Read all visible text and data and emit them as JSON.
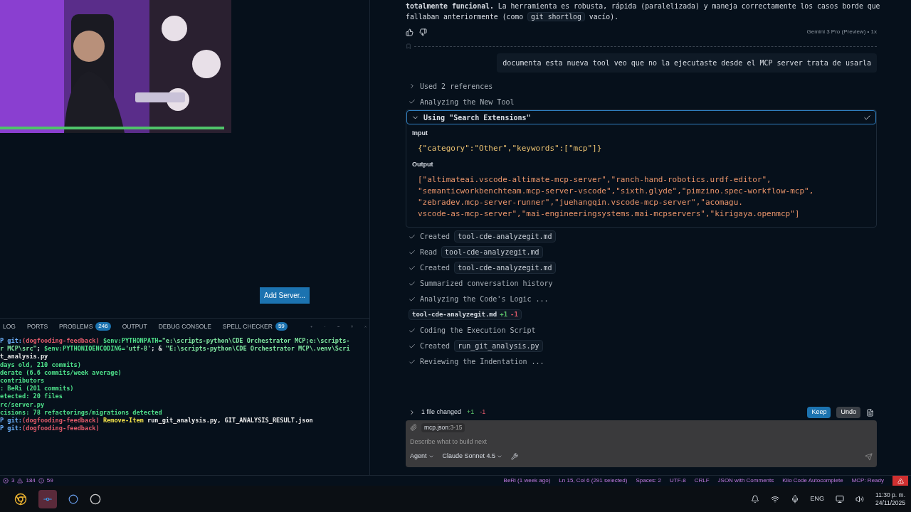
{
  "add_server_button": "Add Server...",
  "panel": {
    "tabs": [
      {
        "label": "LOG",
        "selected": false
      },
      {
        "label": "PORTS",
        "selected": false
      },
      {
        "label": "PROBLEMS",
        "badge": "246",
        "selected": false
      },
      {
        "label": "OUTPUT",
        "selected": false
      },
      {
        "label": "DEBUG CONSOLE",
        "selected": false
      },
      {
        "label": "SPELL CHECKER",
        "badge": "59",
        "selected": false
      }
    ],
    "terminal_lines": [
      [
        {
          "kind": "prompt",
          "text": "P git:"
        },
        {
          "kind": "branch",
          "text": "(dogfooding-feedback)"
        },
        {
          "kind": "out",
          "text": " $env:PYTHONPATH="
        },
        {
          "kind": "str",
          "text": "\"e:\\scripts-python\\CDE Orchestrator MCP;e:\\scripts-"
        }
      ],
      [
        {
          "kind": "str",
          "text": "r MCP\\src\""
        },
        {
          "kind": "plain",
          "text": "; "
        },
        {
          "kind": "out",
          "text": "$env:PYTHONIOENCODING="
        },
        {
          "kind": "str",
          "text": "'utf-8'"
        },
        {
          "kind": "plain",
          "text": "; & "
        },
        {
          "kind": "str",
          "text": "\"E:\\scripts-python\\CDE Orchestrator MCP\\.venv\\Scri"
        }
      ],
      [
        {
          "kind": "plain",
          "text": "t_analysis.py"
        }
      ],
      [
        {
          "kind": "out",
          "text": "days old, 210 commits)"
        }
      ],
      [
        {
          "kind": "out",
          "text": "derate (6.6 commits/week average)"
        }
      ],
      [
        {
          "kind": "out",
          "text": "contributors"
        }
      ],
      [
        {
          "kind": "out",
          "text": ": BeRi (201 commits)"
        }
      ],
      [
        {
          "kind": "out",
          "text": "etected: 20 files"
        }
      ],
      [
        {
          "kind": "out",
          "text": "rc/server.py"
        }
      ],
      [
        {
          "kind": "out",
          "text": "cisions: 78 refactorings/migrations detected"
        }
      ],
      [
        {
          "kind": "prompt",
          "text": "P git:"
        },
        {
          "kind": "branch",
          "text": "(dogfooding-feedback)"
        },
        {
          "kind": "cmd",
          "text": " Remove-Item"
        },
        {
          "kind": "plain",
          "text": " run_git_analysis.py, GIT_ANALYSIS_RESULT.json"
        }
      ],
      [
        {
          "kind": "prompt",
          "text": "P git:"
        },
        {
          "kind": "branch",
          "text": "(dogfooding-feedback)"
        }
      ]
    ]
  },
  "chat": {
    "answer_line": "**totalmente funcional.** La herramienta es robusta, rápida (paralelizada) y maneja correctamente los casos borde que",
    "answer_start": "fallaban anteriormente (como",
    "answer_code": "git shortlog",
    "answer_end": "vacío).",
    "model_label": "Gemini 3 Pro (Preview) • 1x",
    "user_message": "documenta esta nueva tool veo que no la ejecutaste desde el MCP server trata de usarla",
    "steps_before": [
      {
        "kind": "collapsed",
        "text": "Used 2 references"
      },
      {
        "kind": "done",
        "text": "Analyzing the New Tool"
      }
    ],
    "tool": {
      "title": "Using \"Search Extensions\"",
      "expanded": true,
      "done": true,
      "input_label": "Input",
      "input": "{\"category\":\"Other\",\"keywords\":[\"mcp\"]}",
      "output_label": "Output",
      "output": [
        "[\"altimateai.vscode-altimate-mcp-server\",\"ranch-hand-robotics.urdf-editor\",",
        "\"semanticworkbenchteam.mcp-server-vscode\",\"sixth.glyde\",\"pimzino.spec-workflow-mcp\",",
        "\"zebradev.mcp-server-runner\",\"juehangqin.vscode-mcp-server\",\"acomagu.",
        "vscode-as-mcp-server\",\"mai-engineeringsystems.mai-mcpservers\",\"kirigaya.openmcp\"]"
      ]
    },
    "steps_after": [
      {
        "kind": "done",
        "text": "Created",
        "file": "tool-cde-analyzegit.md"
      },
      {
        "kind": "done",
        "text": "Read",
        "file": "tool-cde-analyzegit.md"
      },
      {
        "kind": "done",
        "text": "Created",
        "file": "tool-cde-analyzegit.md"
      },
      {
        "kind": "done",
        "text": "Summarized conversation history"
      },
      {
        "kind": "done",
        "text": "Analyzing the Code's Logic ..."
      },
      {
        "kind": "diff",
        "file": "tool-cde-analyzegit.md",
        "added": "+1",
        "removed": "-1"
      },
      {
        "kind": "done",
        "text": "Coding the Execution Script"
      },
      {
        "kind": "done",
        "text": "Created",
        "file": "run_git_analysis.py"
      },
      {
        "kind": "done",
        "text": "Reviewing the Indentation ..."
      }
    ],
    "changes": {
      "label": "1 file changed",
      "added": "+1",
      "removed": "-1",
      "keep": "Keep",
      "undo": "Undo"
    },
    "input": {
      "context_file": "mcp.json",
      "context_range": ":3-15",
      "placeholder": "Describe what to build next",
      "mode": "Agent",
      "model": "Claude Sonnet 4.5"
    }
  },
  "status_bar": {
    "errors": "3",
    "warnings": "184",
    "infos": "59",
    "items": [
      "BeRi (1 week ago)",
      "Ln 15, Col 6 (291 selected)",
      "Spaces: 2",
      "UTF-8",
      "CRLF",
      "JSON with Comments",
      "Kilo Code Autocomplete",
      "MCP: Ready"
    ]
  },
  "taskbar": {
    "language": "ENG",
    "time": "11:30 p. m.",
    "date": "24/11/2025"
  }
}
